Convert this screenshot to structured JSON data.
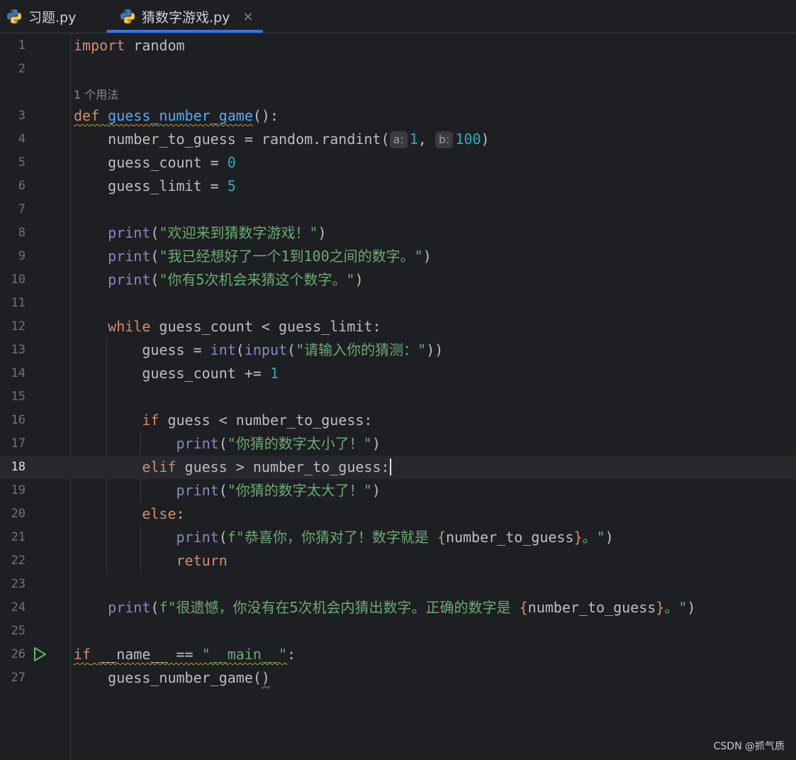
{
  "tabs": [
    {
      "label": "习题.py",
      "icon": "python-file-icon"
    },
    {
      "label": "猜数字游戏.py",
      "icon": "python-file-icon",
      "active": true,
      "close": "×"
    }
  ],
  "editor": {
    "usage_hint": "1 个用法",
    "line_numbers": [
      "1",
      "2",
      "3",
      "4",
      "5",
      "6",
      "7",
      "8",
      "9",
      "10",
      "11",
      "12",
      "13",
      "14",
      "15",
      "16",
      "17",
      "18",
      "19",
      "20",
      "21",
      "22",
      "23",
      "24",
      "25",
      "26",
      "27"
    ],
    "tokens": {
      "l1": [
        "import",
        " random"
      ],
      "l3": [
        "def",
        " ",
        "guess_number_game",
        "():"
      ],
      "l4": [
        "    number_to_guess = random.randint(",
        "a:",
        "1",
        ", ",
        "b:",
        "100",
        ")"
      ],
      "l5": [
        "    guess_count = ",
        "0"
      ],
      "l6": [
        "    guess_limit = ",
        "5"
      ],
      "l8": [
        "    ",
        "print",
        "(",
        "\"欢迎来到猜数字游戏！\"",
        ")"
      ],
      "l9": [
        "    ",
        "print",
        "(",
        "\"我已经想好了一个1到100之间的数字。\"",
        ")"
      ],
      "l10": [
        "    ",
        "print",
        "(",
        "\"你有5次机会来猜这个数字。\"",
        ")"
      ],
      "l12": [
        "    ",
        "while",
        " guess_count < guess_limit:"
      ],
      "l13": [
        "        guess = ",
        "int",
        "(",
        "input",
        "(",
        "\"请输入你的猜测：\"",
        "))"
      ],
      "l14": [
        "        guess_count += ",
        "1"
      ],
      "l16": [
        "        ",
        "if",
        " guess < number_to_guess:"
      ],
      "l17": [
        "            ",
        "print",
        "(",
        "\"你猜的数字太小了！\"",
        ")"
      ],
      "l18": [
        "        ",
        "elif",
        " guess > number_to_guess:"
      ],
      "l19": [
        "            ",
        "print",
        "(",
        "\"你猜的数字太大了！\"",
        ")"
      ],
      "l20": [
        "        ",
        "else",
        ":"
      ],
      "l21": [
        "            ",
        "print",
        "(",
        "f\"恭喜你，你猜对了！数字就是 ",
        "{",
        "number_to_guess",
        "}",
        "。\"",
        ")"
      ],
      "l22": [
        "            ",
        "return"
      ],
      "l24": [
        "    ",
        "print",
        "(",
        "f\"很遗憾，你没有在5次机会内猜出数字。正确的数字是 ",
        "{",
        "number_to_guess",
        "}",
        "。\"",
        ")"
      ],
      "l26": [
        "if",
        " ",
        "__name__",
        " == ",
        "\"__main__\"",
        ":"
      ],
      "l27": [
        "    guess_number_game(",
        ")"
      ]
    }
  },
  "colors": {
    "background": "#1e1f22",
    "keyword": "#cf8e6d",
    "function": "#56a8f5",
    "builtin": "#8888c6",
    "number": "#2aacb8",
    "string": "#6aab73",
    "accent": "#3574f0"
  },
  "watermark": "CSDN @抓气质"
}
